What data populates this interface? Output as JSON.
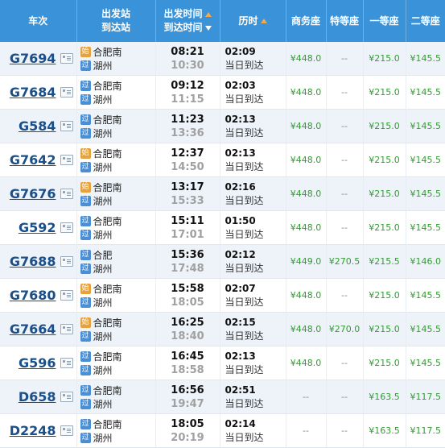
{
  "header": {
    "train": "车次",
    "station_from": "出发站",
    "station_to": "到达站",
    "time_dep": "出发时间",
    "time_arr": "到达时间",
    "duration": "历时",
    "business": "商务座",
    "special": "特等座",
    "first": "一等座",
    "second": "二等座"
  },
  "badges": {
    "start": "始",
    "pass": "过"
  },
  "rows": [
    {
      "train": "G7694",
      "from": "合肥南",
      "from_badge": "始",
      "to": "湖州",
      "to_badge": "过",
      "dep": "08:21",
      "arr": "10:30",
      "dur": "02:09",
      "arrive_note": "当日到达",
      "business": "¥448.0",
      "special": "--",
      "first": "¥215.0",
      "second": "¥145.5"
    },
    {
      "train": "G7684",
      "from": "合肥南",
      "from_badge": "过",
      "to": "湖州",
      "to_badge": "过",
      "dep": "09:12",
      "arr": "11:15",
      "dur": "02:03",
      "arrive_note": "当日到达",
      "business": "¥448.0",
      "special": "--",
      "first": "¥215.0",
      "second": "¥145.5"
    },
    {
      "train": "G584",
      "from": "合肥南",
      "from_badge": "过",
      "to": "湖州",
      "to_badge": "过",
      "dep": "11:23",
      "arr": "13:36",
      "dur": "02:13",
      "arrive_note": "当日到达",
      "business": "¥448.0",
      "special": "--",
      "first": "¥215.0",
      "second": "¥145.5"
    },
    {
      "train": "G7642",
      "from": "合肥南",
      "from_badge": "始",
      "to": "湖州",
      "to_badge": "过",
      "dep": "12:37",
      "arr": "14:50",
      "dur": "02:13",
      "arrive_note": "当日到达",
      "business": "¥448.0",
      "special": "--",
      "first": "¥215.0",
      "second": "¥145.5"
    },
    {
      "train": "G7676",
      "from": "合肥南",
      "from_badge": "始",
      "to": "湖州",
      "to_badge": "过",
      "dep": "13:17",
      "arr": "15:33",
      "dur": "02:16",
      "arrive_note": "当日到达",
      "business": "¥448.0",
      "special": "--",
      "first": "¥215.0",
      "second": "¥145.5"
    },
    {
      "train": "G592",
      "from": "合肥南",
      "from_badge": "过",
      "to": "湖州",
      "to_badge": "过",
      "dep": "15:11",
      "arr": "17:01",
      "dur": "01:50",
      "arrive_note": "当日到达",
      "business": "¥448.0",
      "special": "--",
      "first": "¥215.0",
      "second": "¥145.5"
    },
    {
      "train": "G7688",
      "from": "合肥",
      "from_badge": "过",
      "to": "湖州",
      "to_badge": "过",
      "dep": "15:36",
      "arr": "17:48",
      "dur": "02:12",
      "arrive_note": "当日到达",
      "business": "¥449.0",
      "special": "¥270.5",
      "first": "¥215.5",
      "second": "¥146.0"
    },
    {
      "train": "G7680",
      "from": "合肥南",
      "from_badge": "始",
      "to": "湖州",
      "to_badge": "过",
      "dep": "15:58",
      "arr": "18:05",
      "dur": "02:07",
      "arrive_note": "当日到达",
      "business": "¥448.0",
      "special": "--",
      "first": "¥215.0",
      "second": "¥145.5"
    },
    {
      "train": "G7664",
      "from": "合肥南",
      "from_badge": "始",
      "to": "湖州",
      "to_badge": "过",
      "dep": "16:25",
      "arr": "18:40",
      "dur": "02:15",
      "arrive_note": "当日到达",
      "business": "¥448.0",
      "special": "¥270.0",
      "first": "¥215.0",
      "second": "¥145.5"
    },
    {
      "train": "G596",
      "from": "合肥南",
      "from_badge": "过",
      "to": "湖州",
      "to_badge": "过",
      "dep": "16:45",
      "arr": "18:58",
      "dur": "02:13",
      "arrive_note": "当日到达",
      "business": "¥448.0",
      "special": "--",
      "first": "¥215.0",
      "second": "¥145.5"
    },
    {
      "train": "D658",
      "from": "合肥南",
      "from_badge": "过",
      "to": "湖州",
      "to_badge": "过",
      "dep": "16:56",
      "arr": "19:47",
      "dur": "02:51",
      "arrive_note": "当日到达",
      "business": "--",
      "special": "--",
      "first": "¥163.5",
      "second": "¥117.5"
    },
    {
      "train": "D2248",
      "from": "合肥南",
      "from_badge": "过",
      "to": "湖州",
      "to_badge": "过",
      "dep": "18:05",
      "arr": "20:19",
      "dur": "02:14",
      "arrive_note": "当日到达",
      "business": "--",
      "special": "--",
      "first": "¥163.5",
      "second": "¥117.5"
    }
  ],
  "colors": {
    "header_bg": "#3a93d8",
    "price": "#2f9e2f",
    "start_badge": "#e6a23c",
    "pass_badge": "#4a8fd6",
    "sort_arrow": "#f5a74a"
  }
}
